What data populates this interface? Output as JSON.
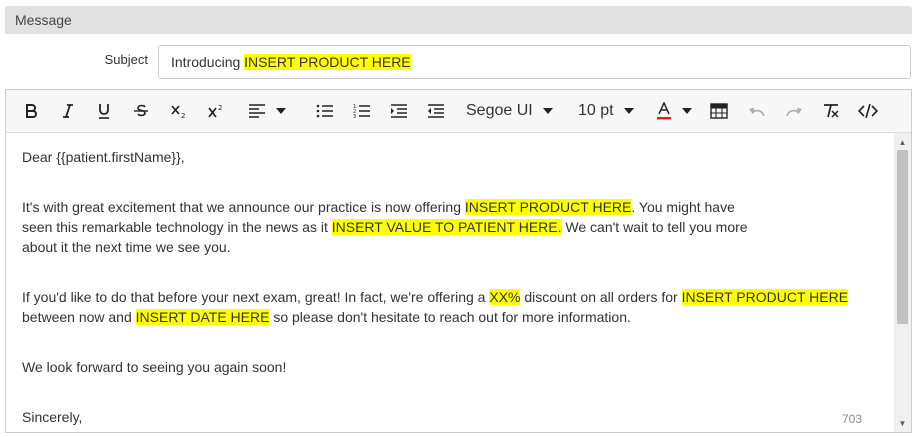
{
  "section": {
    "title": "Message"
  },
  "subject": {
    "label": "Subject",
    "prefix": "Introducing ",
    "highlight": "INSERT PRODUCT HERE"
  },
  "toolbar": {
    "font_family": "Segoe UI",
    "font_size": "10 pt",
    "font_color": "#e02020",
    "icons": [
      "bold-icon",
      "italic-icon",
      "underline-icon",
      "strikethrough-icon",
      "subscript-icon",
      "superscript-icon",
      "align-left-icon",
      "unordered-list-icon",
      "ordered-list-icon",
      "indent-icon",
      "outdent-icon",
      "font-color-icon",
      "table-icon",
      "undo-icon",
      "redo-icon",
      "clear-format-icon",
      "source-code-icon"
    ]
  },
  "body": {
    "greeting": "Dear {{patient.firstName}},",
    "p1_l1_a": "It's with great excitement that we announce our practice is now offering ",
    "p1_l1_h": "INSERT PRODUCT HERE",
    "p1_l1_b": ". You might have",
    "p1_l2_a": "seen this remarkable technology in the news as it ",
    "p1_l2_h": "INSERT VALUE TO PATIENT HERE.",
    "p1_l2_b": " We can't wait to tell you more",
    "p1_l3": "about it the next time we see you.",
    "p2_l1_a": "If you'd like to do that before your next exam, great! In fact, we're offering a ",
    "p2_l1_h1": "XX%",
    "p2_l1_b": " discount on all orders for ",
    "p2_l1_h2": "INSERT PRODUCT HERE",
    "p2_l2_a": "between now and ",
    "p2_l2_h": "INSERT DATE HERE",
    "p2_l2_b": " so please don't hesitate to reach out for more information.",
    "p3": "We look forward to seeing you again soon!",
    "closing": "Sincerely,"
  },
  "char_count": "703",
  "colors": {
    "highlight": "#ffff00",
    "header_bg": "#e1e1e1",
    "toolbar_bg": "#f7f7f7"
  }
}
